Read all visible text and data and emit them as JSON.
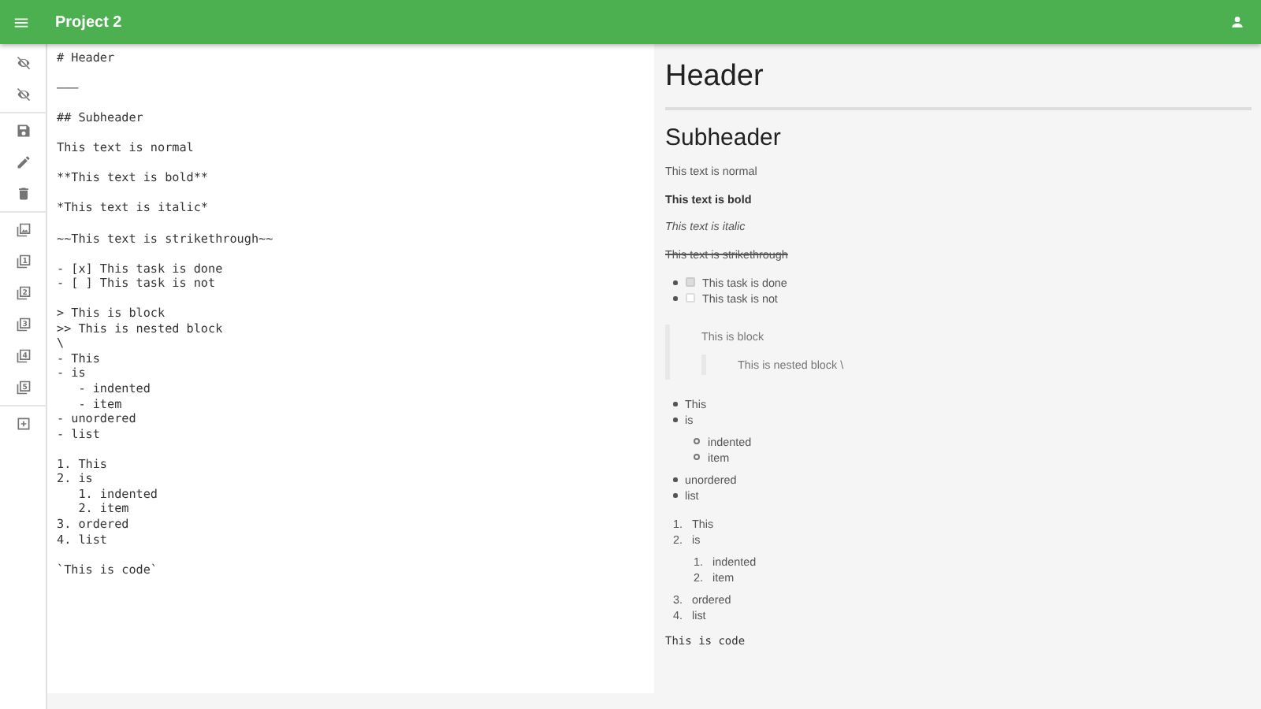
{
  "app_bar": {
    "title": "Project 2"
  },
  "sidebar": [
    {
      "kind": "eye-off"
    },
    {
      "kind": "eye-off"
    },
    {
      "kind": "divider"
    },
    {
      "kind": "save"
    },
    {
      "kind": "pencil"
    },
    {
      "kind": "trash"
    },
    {
      "kind": "divider"
    },
    {
      "kind": "image"
    },
    {
      "kind": "layer",
      "label": "1"
    },
    {
      "kind": "layer",
      "label": "2"
    },
    {
      "kind": "layer",
      "label": "3"
    },
    {
      "kind": "layer",
      "label": "4"
    },
    {
      "kind": "layer",
      "label": "5"
    },
    {
      "kind": "divider"
    },
    {
      "kind": "add-box"
    }
  ],
  "editor": {
    "blocks": [
      [
        "# Header"
      ],
      [
        "———"
      ],
      [
        "## Subheader"
      ],
      [
        "This text is normal"
      ],
      [
        "**This text is bold**"
      ],
      [
        "*This text is italic*"
      ],
      [
        "~~This text is strikethrough~~"
      ],
      [
        "- [x] This task is done",
        "- [ ] This task is not"
      ],
      [
        "> This is block",
        ">> This is nested block",
        "\\",
        "- This",
        "- is",
        "   - indented",
        "   - item",
        "- unordered",
        "- list"
      ],
      [
        "1. This",
        "2. is",
        "   1. indented",
        "   2. item",
        "3. ordered",
        "4. list"
      ],
      [
        "`This is code`"
      ]
    ]
  },
  "preview": [
    {
      "kind": "h1",
      "text": "Header"
    },
    {
      "kind": "hr"
    },
    {
      "kind": "h2",
      "text": "Subheader"
    },
    {
      "kind": "paragraph",
      "text": "This text is normal"
    },
    {
      "kind": "bold",
      "text": "This text is bold"
    },
    {
      "kind": "italic",
      "text": "This text is italic"
    },
    {
      "kind": "strike",
      "text": "This text is strikethrough"
    },
    {
      "kind": "tasks",
      "items": [
        {
          "text": "This task is done",
          "checked": true
        },
        {
          "text": "This task is not",
          "checked": false
        }
      ]
    },
    {
      "kind": "quote",
      "text": "This is block",
      "children": [
        {
          "text": "This is nested block \\"
        }
      ]
    },
    {
      "kind": "ul",
      "items": [
        {
          "text": "This"
        },
        {
          "text": "is",
          "children": [
            {
              "text": "indented"
            },
            {
              "text": "item"
            }
          ]
        },
        {
          "text": "unordered"
        },
        {
          "text": "list"
        }
      ]
    },
    {
      "kind": "ol",
      "items": [
        {
          "marker": "1.",
          "text": "This"
        },
        {
          "marker": "2.",
          "text": "is",
          "children": [
            {
              "marker": "1.",
              "text": "indented"
            },
            {
              "marker": "2.",
              "text": "item"
            }
          ]
        },
        {
          "marker": "3.",
          "text": "ordered"
        },
        {
          "marker": "4.",
          "text": "list"
        }
      ]
    },
    {
      "kind": "code",
      "text": "This is code"
    }
  ]
}
